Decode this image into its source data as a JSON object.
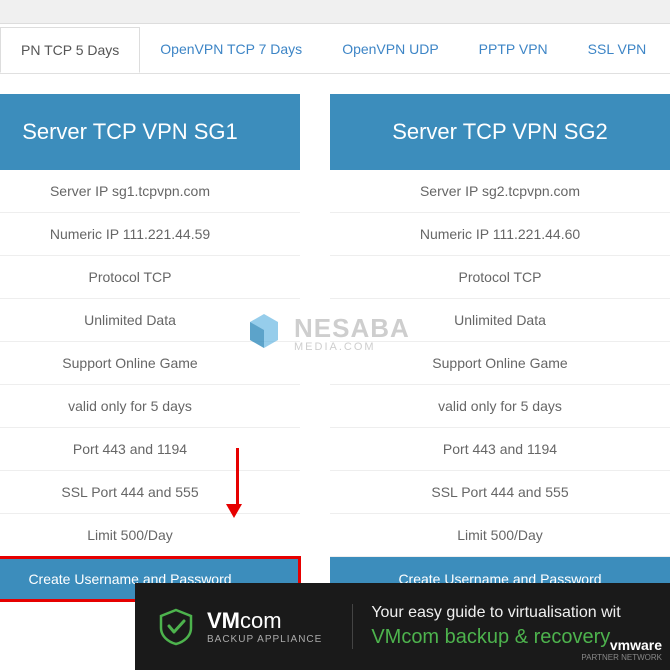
{
  "tabs": {
    "active": "PN TCP 5 Days",
    "items": [
      "OpenVPN TCP 7 Days",
      "OpenVPN UDP",
      "PPTP VPN",
      "SSL VPN"
    ]
  },
  "servers": [
    {
      "title": "Server TCP VPN SG1",
      "rows": [
        "Server IP sg1.tcpvpn.com",
        "Numeric IP 111.221.44.59",
        "Protocol TCP",
        "Unlimited Data",
        "Support Online Game",
        "valid only for 5 days",
        "Port 443 and 1194",
        "SSL Port 444 and 555",
        "Limit 500/Day"
      ],
      "button": "Create Username and Password"
    },
    {
      "title": "Server TCP VPN SG2",
      "rows": [
        "Server IP sg2.tcpvpn.com",
        "Numeric IP 111.221.44.60",
        "Protocol TCP",
        "Unlimited Data",
        "Support Online Game",
        "valid only for 5 days",
        "Port 443 and 1194",
        "SSL Port 444 and 555",
        "Limit 500/Day"
      ],
      "button": "Create Username and Password"
    }
  ],
  "watermark": {
    "text": "NESABA",
    "sub": "MEDIA.COM"
  },
  "banner": {
    "logo_title_pre": "VM",
    "logo_title_post": "com",
    "logo_sub": "BACKUP APPLIANCE",
    "headline": "Your easy guide to virtualisation wit",
    "product": "VMcom backup & recovery",
    "partner_logo": "vmware",
    "partner_sub": "PARTNER NETWORK"
  }
}
